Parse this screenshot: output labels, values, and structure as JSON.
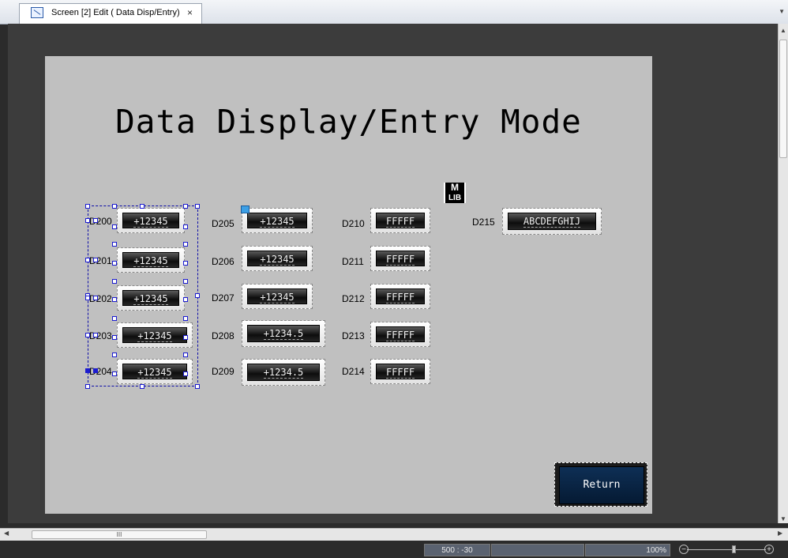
{
  "tab": {
    "title": "Screen [2] Edit ( Data Disp/Entry)",
    "close": "×",
    "icon": "screen-edit-icon"
  },
  "screen": {
    "title": "Data Display/Entry Mode",
    "library_badge": {
      "top": "M",
      "bottom": "LIB"
    },
    "return_label": "Return"
  },
  "fields": [
    {
      "label": "D200",
      "value": "+12345"
    },
    {
      "label": "D201",
      "value": "+12345"
    },
    {
      "label": "D202",
      "value": "+12345"
    },
    {
      "label": "D203",
      "value": "+12345"
    },
    {
      "label": "D204",
      "value": "+12345"
    },
    {
      "label": "D205",
      "value": "+12345"
    },
    {
      "label": "D206",
      "value": "+12345"
    },
    {
      "label": "D207",
      "value": "+12345"
    },
    {
      "label": "D208",
      "value": "+1234.5"
    },
    {
      "label": "D209",
      "value": "+1234.5"
    },
    {
      "label": "D210",
      "value": "FFFFF"
    },
    {
      "label": "D211",
      "value": "FFFFF"
    },
    {
      "label": "D212",
      "value": "FFFFF"
    },
    {
      "label": "D213",
      "value": "FFFFF"
    },
    {
      "label": "D214",
      "value": "FFFFF"
    },
    {
      "label": "D215",
      "value": "ABCDEFGHIJ"
    }
  ],
  "status": {
    "coords": "500 : -30",
    "zoom": "100%"
  },
  "scrollbar": {
    "h_thumb_grip": "III"
  }
}
